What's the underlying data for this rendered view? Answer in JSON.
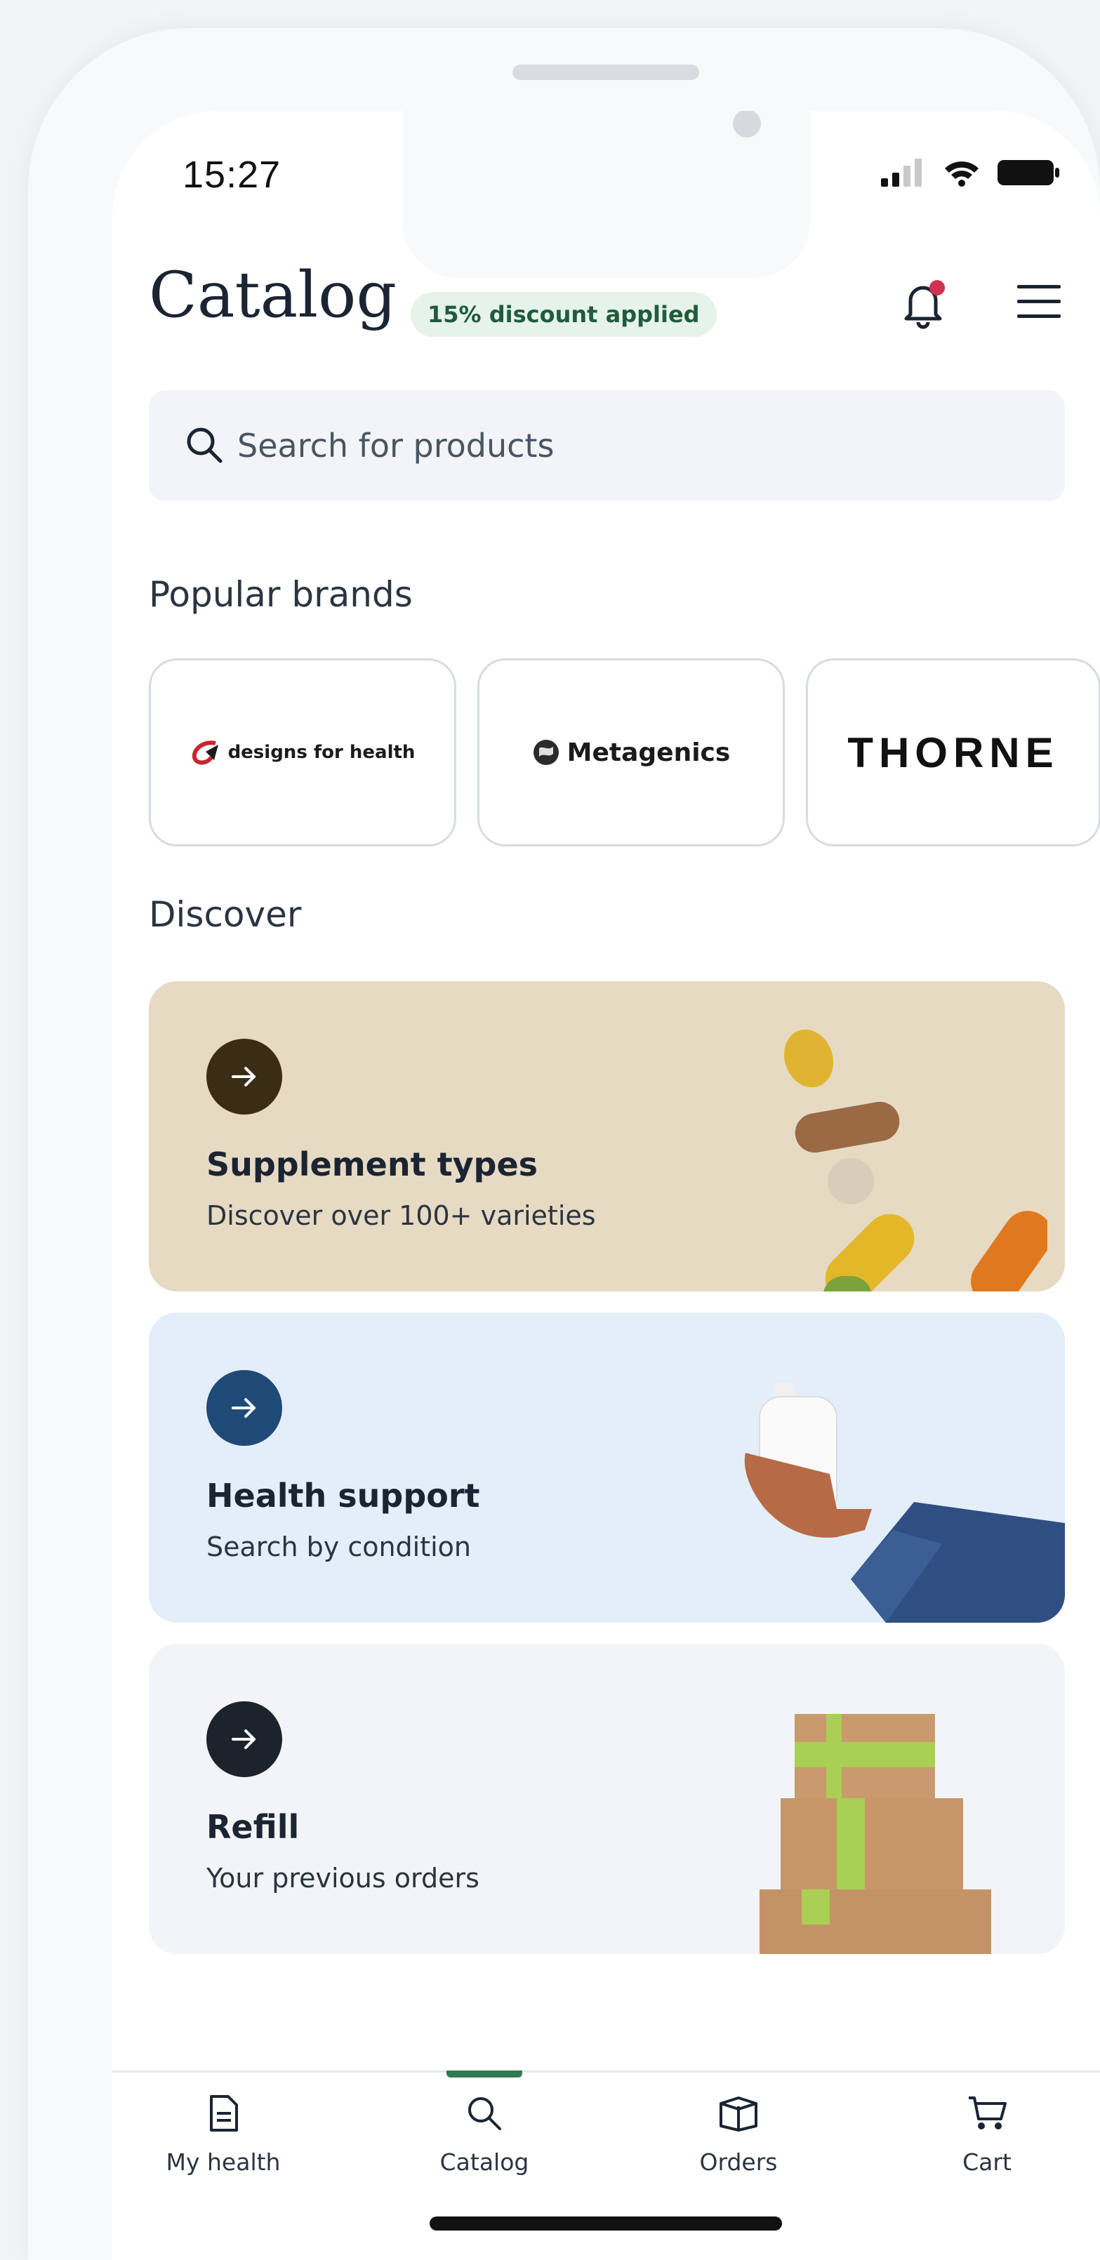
{
  "status_bar": {
    "time": "15:27"
  },
  "header": {
    "title": "Catalog",
    "discount_badge": "15% discount applied"
  },
  "search": {
    "placeholder": "Search for products"
  },
  "popular_brands": {
    "label": "Popular brands",
    "brands": [
      "designs for health",
      "Metagenics",
      "THORNE"
    ]
  },
  "discover": {
    "label": "Discover",
    "cards": [
      {
        "title": "Supplement types",
        "subtitle": "Discover over 100+ varieties",
        "bg": "#e6dac3",
        "arrow_bg": "#3b2c16"
      },
      {
        "title": "Health support",
        "subtitle": "Search by condition",
        "bg": "#e4eef9",
        "arrow_bg": "#1f4a78"
      },
      {
        "title": "Refill",
        "subtitle": "Your previous orders",
        "bg": "#f3f4f7",
        "arrow_bg": "#1d232c"
      }
    ]
  },
  "tabbar": {
    "items": [
      {
        "label": "My health",
        "icon": "document-icon"
      },
      {
        "label": "Catalog",
        "icon": "search-icon",
        "active": true
      },
      {
        "label": "Orders",
        "icon": "box-icon"
      },
      {
        "label": "Cart",
        "icon": "cart-icon"
      }
    ]
  },
  "colors": {
    "accent": "#2f7a53",
    "badge_bg": "#e6f3ea",
    "notification": "#d0314e"
  }
}
